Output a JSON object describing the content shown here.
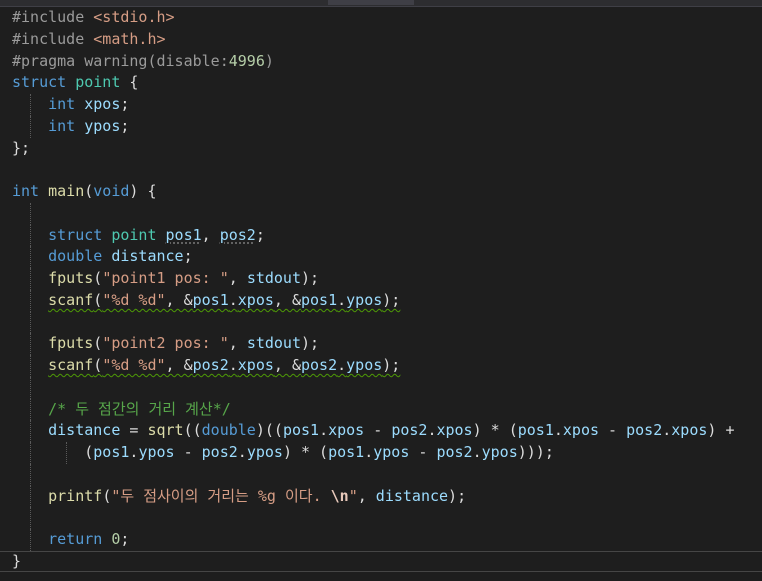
{
  "window": {
    "top_tab_label": ""
  },
  "colors": {
    "background": "#1e1e1e",
    "keyword": "#569cd6",
    "type": "#4ec9b0",
    "function": "#dcdcaa",
    "variable": "#9cdcfe",
    "string": "#d69d85",
    "comment": "#57a64a",
    "number": "#b5cea8",
    "preprocessor": "#9b9b9b"
  },
  "code": {
    "l1": {
      "a": "#include ",
      "b": "<stdio.h>"
    },
    "l2": {
      "a": "#include ",
      "b": "<math.h>"
    },
    "l3": {
      "a": "#pragma warning(disable:",
      "b": "4996",
      "c": ")"
    },
    "l4": {
      "a": "struct",
      "b": "point",
      "c": " {"
    },
    "l5": {
      "a": "int",
      "b": "xpos",
      "c": ";"
    },
    "l6": {
      "a": "int",
      "b": "ypos",
      "c": ";"
    },
    "l7": {
      "a": "};"
    },
    "l9": {
      "a": "int",
      "b": "main",
      "c": "(",
      "d": "void",
      "e": ") {"
    },
    "l11": {
      "a": "struct",
      "b": "point",
      "c": "pos1",
      "d": ", ",
      "e": "pos2",
      "f": ";"
    },
    "l12": {
      "a": "double",
      "b": "distance",
      "c": ";"
    },
    "l13": {
      "a": "fputs",
      "b": "(",
      "c": "\"point1 pos: \"",
      "d": ", ",
      "e": "stdout",
      "f": ");"
    },
    "l14": {
      "a": "scanf",
      "b": "(",
      "c": "\"%d %d\"",
      "d": ", &",
      "e": "pos1",
      "f": ".",
      "g": "xpos",
      "h": ", &",
      "i": "pos1",
      "j": ".",
      "k": "ypos",
      "l": ");"
    },
    "l16": {
      "a": "fputs",
      "b": "(",
      "c": "\"point2 pos: \"",
      "d": ", ",
      "e": "stdout",
      "f": ");"
    },
    "l17": {
      "a": "scanf",
      "b": "(",
      "c": "\"%d %d\"",
      "d": ", &",
      "e": "pos2",
      "f": ".",
      "g": "xpos",
      "h": ", &",
      "i": "pos2",
      "j": ".",
      "k": "ypos",
      "l": ");"
    },
    "l19": {
      "a": "/* 두 점간의 거리 계산*/"
    },
    "l20": {
      "a": "distance",
      "b": " = ",
      "c": "sqrt",
      "d": "((",
      "e": "double",
      "f": ")((",
      "g": "pos1",
      "h": ".",
      "i": "xpos",
      "j": " - ",
      "k": "pos2",
      "l": ".",
      "m": "xpos",
      "n": ") * (",
      "o": "pos1",
      "p": ".",
      "q": "xpos",
      "r": " - ",
      "s": "pos2",
      "t": ".",
      "u": "xpos",
      "v": ") +"
    },
    "l21": {
      "a": "(",
      "b": "pos1",
      "c": ".",
      "d": "ypos",
      "e": " - ",
      "f": "pos2",
      "g": ".",
      "h": "ypos",
      "i": ") * (",
      "j": "pos1",
      "k": ".",
      "l": "ypos",
      "m": " - ",
      "n": "pos2",
      "o": ".",
      "p": "ypos",
      "q": ")));"
    },
    "l23": {
      "a": "printf",
      "b": "(",
      "c": "\"두 점사이의 거리는 ",
      "d": "%g",
      "e": " 이다. ",
      "f": "\\n",
      "g": "\"",
      "h": ", ",
      "i": "distance",
      "j": ");"
    },
    "l25": {
      "a": "return",
      "b": " ",
      "c": "0",
      "d": ";"
    },
    "l26": {
      "a": "}"
    }
  }
}
